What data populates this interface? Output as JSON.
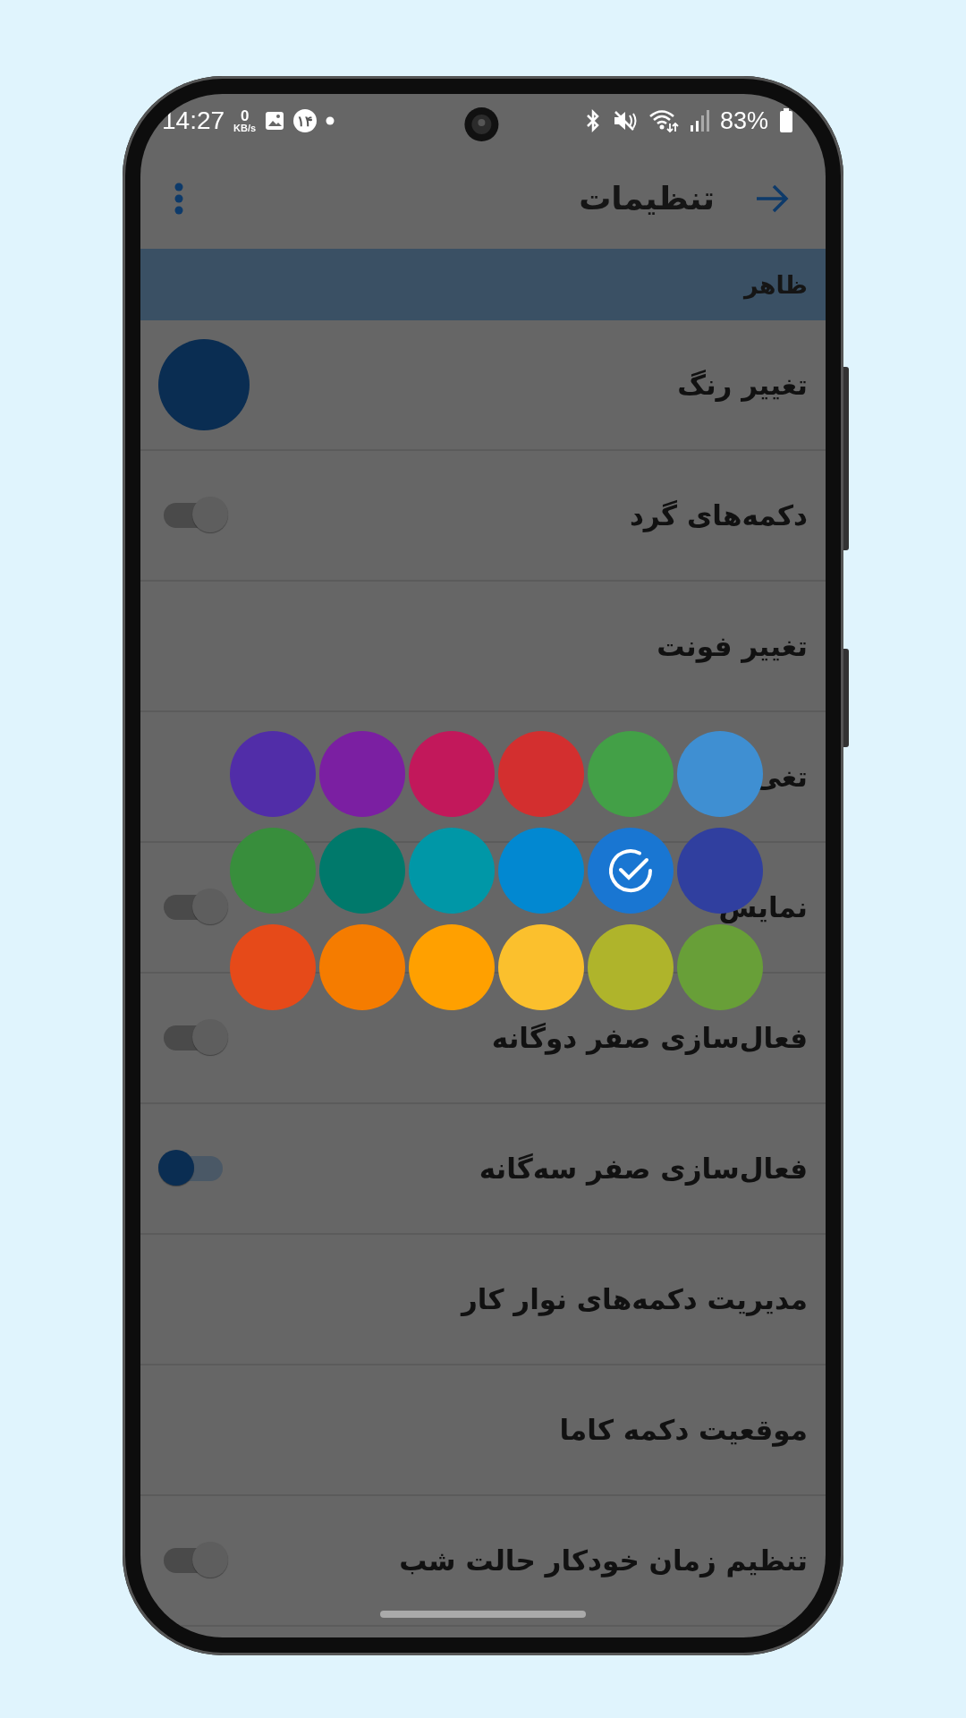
{
  "status_bar": {
    "time": "14:27",
    "net_speed": "0",
    "net_unit": "KB/s",
    "notification_badge": "۱۴",
    "battery": "83%"
  },
  "header": {
    "title": "تنظیمات"
  },
  "section": {
    "title": "ظاهر"
  },
  "rows": [
    {
      "kind": "color",
      "label": "تغییر رنگ",
      "color": "#0a2d52"
    },
    {
      "kind": "toggle",
      "label": "دکمه‌های گرد",
      "on": false
    },
    {
      "kind": "plain",
      "label": "تغییر فونت"
    },
    {
      "kind": "plain",
      "label": "تغی"
    },
    {
      "kind": "toggle",
      "label": "نمایش",
      "on": false
    },
    {
      "kind": "toggle",
      "label": "فعال‌سازی صفر دوگانه",
      "on": false
    },
    {
      "kind": "toggle",
      "label": "فعال‌سازی صفر سه‌گانه",
      "on": true
    },
    {
      "kind": "plain",
      "label": "مدیریت دکمه‌های نوار کار"
    },
    {
      "kind": "plain",
      "label": "موقعیت دکمه کاما"
    },
    {
      "kind": "toggle",
      "label": "تنظیم زمان خودکار حالت شب",
      "on": false
    }
  ],
  "palette": [
    {
      "color": "#512da8",
      "selected": false
    },
    {
      "color": "#7b1fa2",
      "selected": false
    },
    {
      "color": "#c2185b",
      "selected": false
    },
    {
      "color": "#d32f2f",
      "selected": false
    },
    {
      "color": "#43a047",
      "selected": false
    },
    {
      "color": "#3f8fd2",
      "selected": false
    },
    {
      "color": "#388e3c",
      "selected": false
    },
    {
      "color": "#00796b",
      "selected": false
    },
    {
      "color": "#0097a7",
      "selected": false
    },
    {
      "color": "#0288d1",
      "selected": false
    },
    {
      "color": "#1976d2",
      "selected": true
    },
    {
      "color": "#303f9f",
      "selected": false
    },
    {
      "color": "#e64a19",
      "selected": false
    },
    {
      "color": "#f57c00",
      "selected": false
    },
    {
      "color": "#ffa000",
      "selected": false
    },
    {
      "color": "#fbc02d",
      "selected": false
    },
    {
      "color": "#afb42b",
      "selected": false
    },
    {
      "color": "#689f38",
      "selected": false
    }
  ]
}
